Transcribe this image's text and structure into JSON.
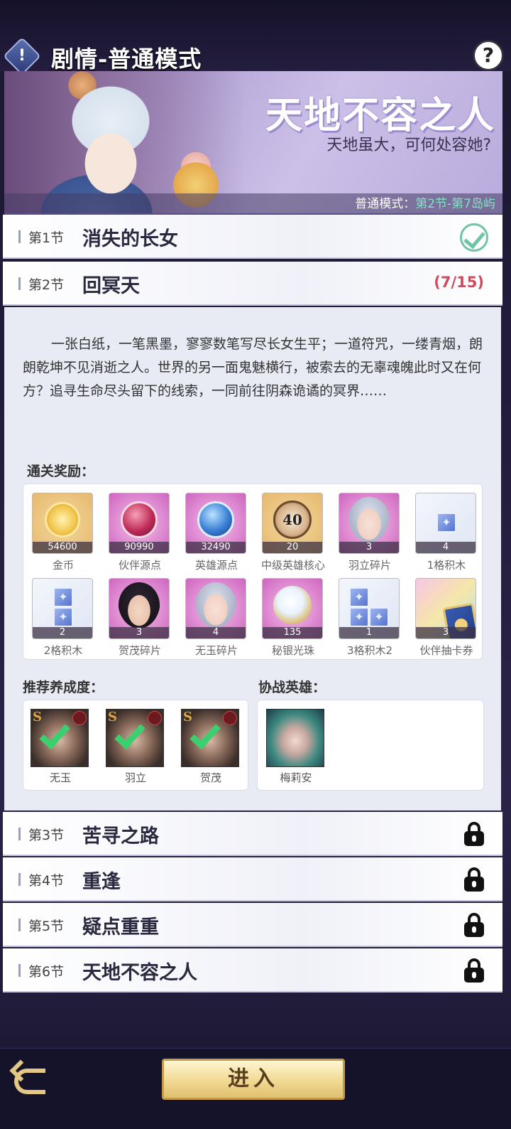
{
  "header": {
    "title": "剧情-普通模式",
    "alert_icon": "!",
    "help_icon": "?"
  },
  "banner": {
    "title": "天地不容之人",
    "subtitle": "天地虽大，可何处容她?",
    "footer_prefix": "普通模式：",
    "footer_highlight": "第2节-第7岛屿"
  },
  "sections": [
    {
      "num": "第1节",
      "name": "消失的长女",
      "state": "completed"
    },
    {
      "num": "第2节",
      "name": "回冥天",
      "progress": "(7/15)",
      "state": "current"
    },
    {
      "num": "第3节",
      "name": "苦寻之路",
      "state": "locked"
    },
    {
      "num": "第4节",
      "name": "重逢",
      "state": "locked"
    },
    {
      "num": "第5节",
      "name": "疑点重重",
      "state": "locked"
    },
    {
      "num": "第6节",
      "name": "天地不容之人",
      "state": "locked"
    }
  ],
  "detail": {
    "story": "一张白纸，一笔黑墨，寥寥数笔写尽长女生平；一道符咒，一缕青烟，朗朗乾坤不见消逝之人。世界的另一面鬼魅横行，被索去的无辜魂魄此时又在何方？追寻生命尽头留下的线索，一同前往阴森诡谲的冥界……",
    "rewards_label": "通关奖励：",
    "rewards": [
      {
        "name": "金币",
        "count": "54600",
        "icon": "gold-coin-icon"
      },
      {
        "name": "伙伴源点",
        "count": "90990",
        "icon": "partner-origin-icon"
      },
      {
        "name": "英雄源点",
        "count": "32490",
        "icon": "hero-origin-icon"
      },
      {
        "name": "中级英雄核心",
        "count": "20",
        "icon": "hero-core-icon",
        "core_level": "40"
      },
      {
        "name": "羽立碎片",
        "count": "3",
        "icon": "yuli-fragment-icon"
      },
      {
        "name": "1格积木",
        "count": "4",
        "icon": "block-1-icon"
      },
      {
        "name": "2格积木",
        "count": "2",
        "icon": "block-2-icon"
      },
      {
        "name": "贺茂碎片",
        "count": "3",
        "icon": "hemao-fragment-icon"
      },
      {
        "name": "无玉碎片",
        "count": "4",
        "icon": "wuyu-fragment-icon"
      },
      {
        "name": "秘银光珠",
        "count": "135",
        "icon": "mithril-pearl-icon"
      },
      {
        "name": "3格积木2",
        "count": "1",
        "icon": "block-3-icon"
      },
      {
        "name": "伙伴抽卡券",
        "count": "3",
        "icon": "partner-card-ticket-icon"
      }
    ],
    "recommend_label": "推荐养成度：",
    "recommend_heroes": [
      {
        "name": "无玉",
        "rank": "S"
      },
      {
        "name": "羽立",
        "rank": "S"
      },
      {
        "name": "贺茂",
        "rank": "S"
      }
    ],
    "ally_label": "协战英雄：",
    "ally_heroes": [
      {
        "name": "梅莉安"
      }
    ]
  },
  "footer": {
    "enter_label": "进入"
  },
  "colors": {
    "progress": "#d04a5c",
    "check": "#6fc4a6",
    "highlight": "#7fe3c4",
    "enter_button": "#f2dc97"
  }
}
